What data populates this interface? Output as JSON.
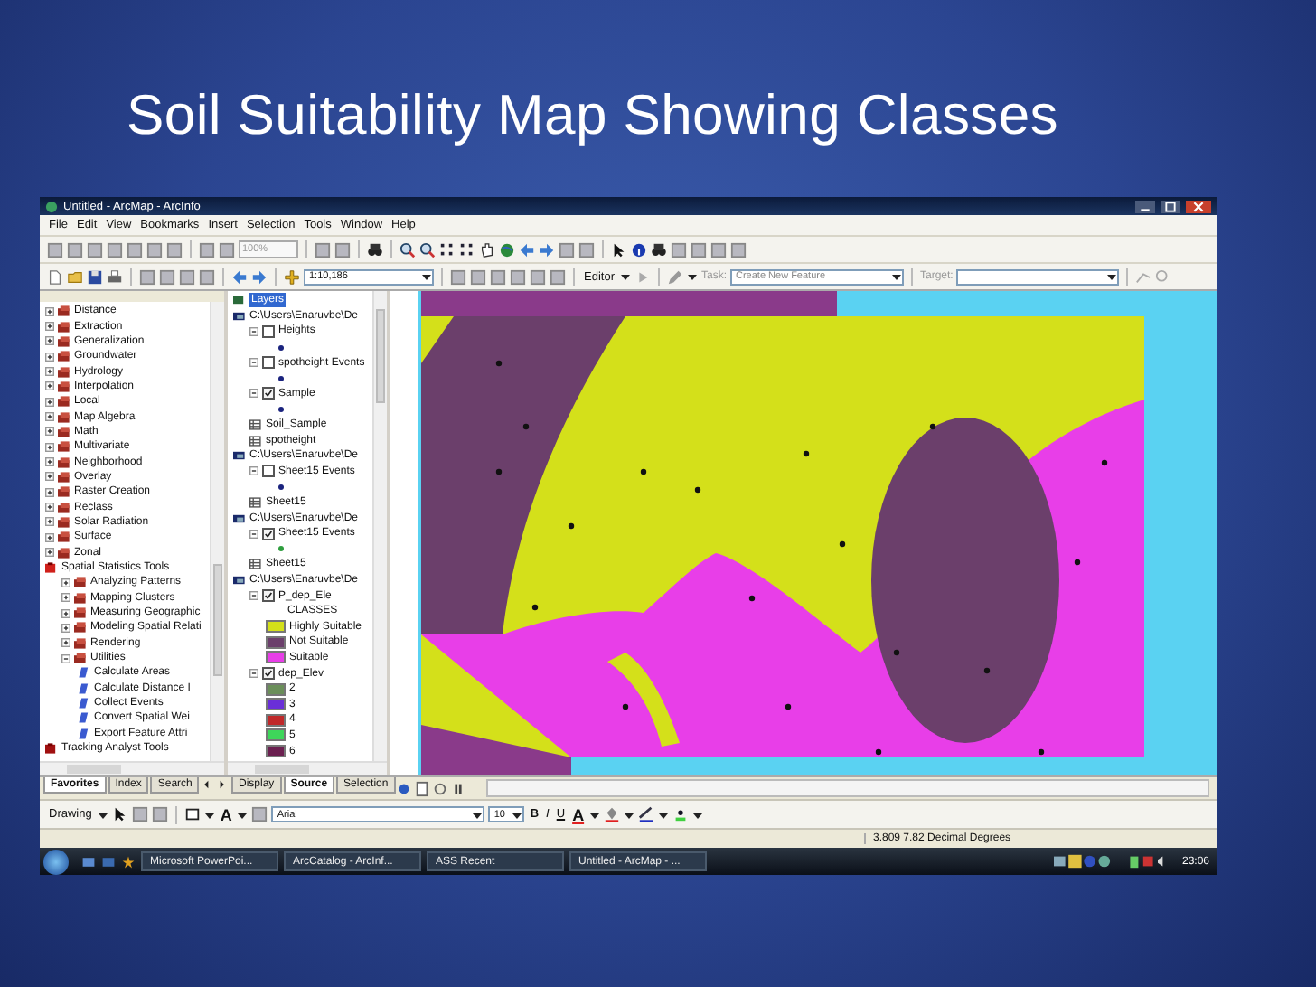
{
  "slide_title": "Soil Suitability Map Showing Classes",
  "window": {
    "title": "Untitled - ArcMap - ArcInfo"
  },
  "menu": [
    "File",
    "Edit",
    "View",
    "Bookmarks",
    "Insert",
    "Selection",
    "Tools",
    "Window",
    "Help"
  ],
  "toolbar_1": {
    "zoom_field": "100%"
  },
  "toolbar_2": {
    "scale": "1:10,186",
    "editor": "Editor",
    "task_label": "Task:",
    "task": "Create New Feature",
    "target_label": "Target:"
  },
  "toolbox": {
    "items": [
      {
        "kind": "toolset",
        "name": "Distance",
        "expanded": false
      },
      {
        "kind": "toolset",
        "name": "Extraction",
        "expanded": false
      },
      {
        "kind": "toolset",
        "name": "Generalization",
        "expanded": false
      },
      {
        "kind": "toolset",
        "name": "Groundwater",
        "expanded": false
      },
      {
        "kind": "toolset",
        "name": "Hydrology",
        "expanded": false
      },
      {
        "kind": "toolset",
        "name": "Interpolation",
        "expanded": false
      },
      {
        "kind": "toolset",
        "name": "Local",
        "expanded": false
      },
      {
        "kind": "toolset",
        "name": "Map Algebra",
        "expanded": false
      },
      {
        "kind": "toolset",
        "name": "Math",
        "expanded": false
      },
      {
        "kind": "toolset",
        "name": "Multivariate",
        "expanded": false
      },
      {
        "kind": "toolset",
        "name": "Neighborhood",
        "expanded": false
      },
      {
        "kind": "toolset",
        "name": "Overlay",
        "expanded": false
      },
      {
        "kind": "toolset",
        "name": "Raster Creation",
        "expanded": false
      },
      {
        "kind": "toolset",
        "name": "Reclass",
        "expanded": false
      },
      {
        "kind": "toolset",
        "name": "Solar Radiation",
        "expanded": false
      },
      {
        "kind": "toolset",
        "name": "Surface",
        "expanded": false
      },
      {
        "kind": "toolset",
        "name": "Zonal",
        "expanded": false
      },
      {
        "kind": "toolbox",
        "name": "Spatial Statistics Tools",
        "expanded": true,
        "children": [
          {
            "kind": "toolset",
            "name": "Analyzing Patterns",
            "expanded": false
          },
          {
            "kind": "toolset",
            "name": "Mapping Clusters",
            "expanded": false
          },
          {
            "kind": "toolset",
            "name": "Measuring Geographic",
            "expanded": false
          },
          {
            "kind": "toolset",
            "name": "Modeling Spatial Relati",
            "expanded": false
          },
          {
            "kind": "toolset",
            "name": "Rendering",
            "expanded": false
          },
          {
            "kind": "toolset",
            "name": "Utilities",
            "expanded": true,
            "children": [
              {
                "kind": "tool",
                "name": "Calculate Areas"
              },
              {
                "kind": "tool",
                "name": "Calculate Distance I"
              },
              {
                "kind": "tool",
                "name": "Collect Events"
              },
              {
                "kind": "tool",
                "name": "Convert Spatial Wei"
              },
              {
                "kind": "tool",
                "name": "Export Feature Attri"
              }
            ]
          }
        ]
      },
      {
        "kind": "toolbox",
        "name": "Tracking Analyst Tools",
        "expanded": false
      }
    ]
  },
  "toolbox_tabs": [
    {
      "label": "Favorites",
      "selected": true
    },
    {
      "label": "Index",
      "selected": false
    },
    {
      "label": "Search",
      "selected": false
    }
  ],
  "toc": {
    "root": "Layers",
    "sources": [
      {
        "path": "C:\\Users\\Enaruvbe\\De",
        "children": [
          {
            "kind": "layer",
            "name": "Heights",
            "checked": false,
            "expanded": true,
            "children": [
              {
                "kind": "point",
                "color": "#1a237e"
              }
            ]
          },
          {
            "kind": "layer",
            "name": "spotheight Events",
            "checked": false,
            "expanded": true,
            "children": [
              {
                "kind": "point",
                "color": "#1a237e"
              }
            ]
          },
          {
            "kind": "layer",
            "name": "Sample",
            "checked": true,
            "expanded": true,
            "children": [
              {
                "kind": "point",
                "color": "#1a237e"
              }
            ]
          },
          {
            "kind": "table",
            "name": "Soil_Sample"
          },
          {
            "kind": "table",
            "name": "spotheight"
          }
        ]
      },
      {
        "path": "C:\\Users\\Enaruvbe\\De",
        "children": [
          {
            "kind": "layer",
            "name": "Sheet15 Events",
            "checked": false,
            "expanded": true,
            "children": [
              {
                "kind": "point",
                "color": "#1a237e"
              }
            ]
          },
          {
            "kind": "table",
            "name": "Sheet15"
          }
        ]
      },
      {
        "path": "C:\\Users\\Enaruvbe\\De",
        "children": [
          {
            "kind": "layer",
            "name": "Sheet15 Events",
            "checked": true,
            "expanded": true,
            "children": [
              {
                "kind": "point",
                "color": "#2e9e3e"
              }
            ]
          },
          {
            "kind": "table",
            "name": "Sheet15"
          }
        ]
      },
      {
        "path": "C:\\Users\\Enaruvbe\\De",
        "children": [
          {
            "kind": "layer",
            "name": "P_dep_Ele",
            "checked": true,
            "expanded": true,
            "children": [
              {
                "kind": "heading",
                "name": "CLASSES"
              },
              {
                "kind": "swatch",
                "name": "Highly Suitable",
                "color": "#d4e01a"
              },
              {
                "kind": "swatch",
                "name": "Not Suitable",
                "color": "#6b3f6b"
              },
              {
                "kind": "swatch",
                "name": "Suitable",
                "color": "#e83ee8"
              }
            ]
          },
          {
            "kind": "layer",
            "name": "dep_Elev",
            "checked": true,
            "expanded": true,
            "children": [
              {
                "kind": "swatch",
                "name": "2",
                "color": "#6b8f5a"
              },
              {
                "kind": "swatch",
                "name": "3",
                "color": "#6a2fd8"
              },
              {
                "kind": "swatch",
                "name": "4",
                "color": "#c0282a"
              },
              {
                "kind": "swatch",
                "name": "5",
                "color": "#3ed65a"
              },
              {
                "kind": "swatch",
                "name": "6",
                "color": "#6b2050"
              }
            ]
          }
        ]
      }
    ]
  },
  "toc_tabs": [
    {
      "label": "Display",
      "selected": false
    },
    {
      "label": "Source",
      "selected": true
    },
    {
      "label": "Selection",
      "selected": false
    }
  ],
  "drawing_toolbar": {
    "label": "Drawing",
    "text_tool": "A",
    "font": "Arial",
    "size": "10",
    "bold": "B",
    "italic": "I",
    "underline": "U",
    "font_color": "A"
  },
  "status_bar": {
    "coordinates": "3.809  7.82 Decimal Degrees"
  },
  "taskbar": {
    "items": [
      "Microsoft PowerPoi...",
      "ArcCatalog - ArcInf...",
      "ASS Recent",
      "Untitled - ArcMap - ..."
    ],
    "clock": "23:06"
  }
}
